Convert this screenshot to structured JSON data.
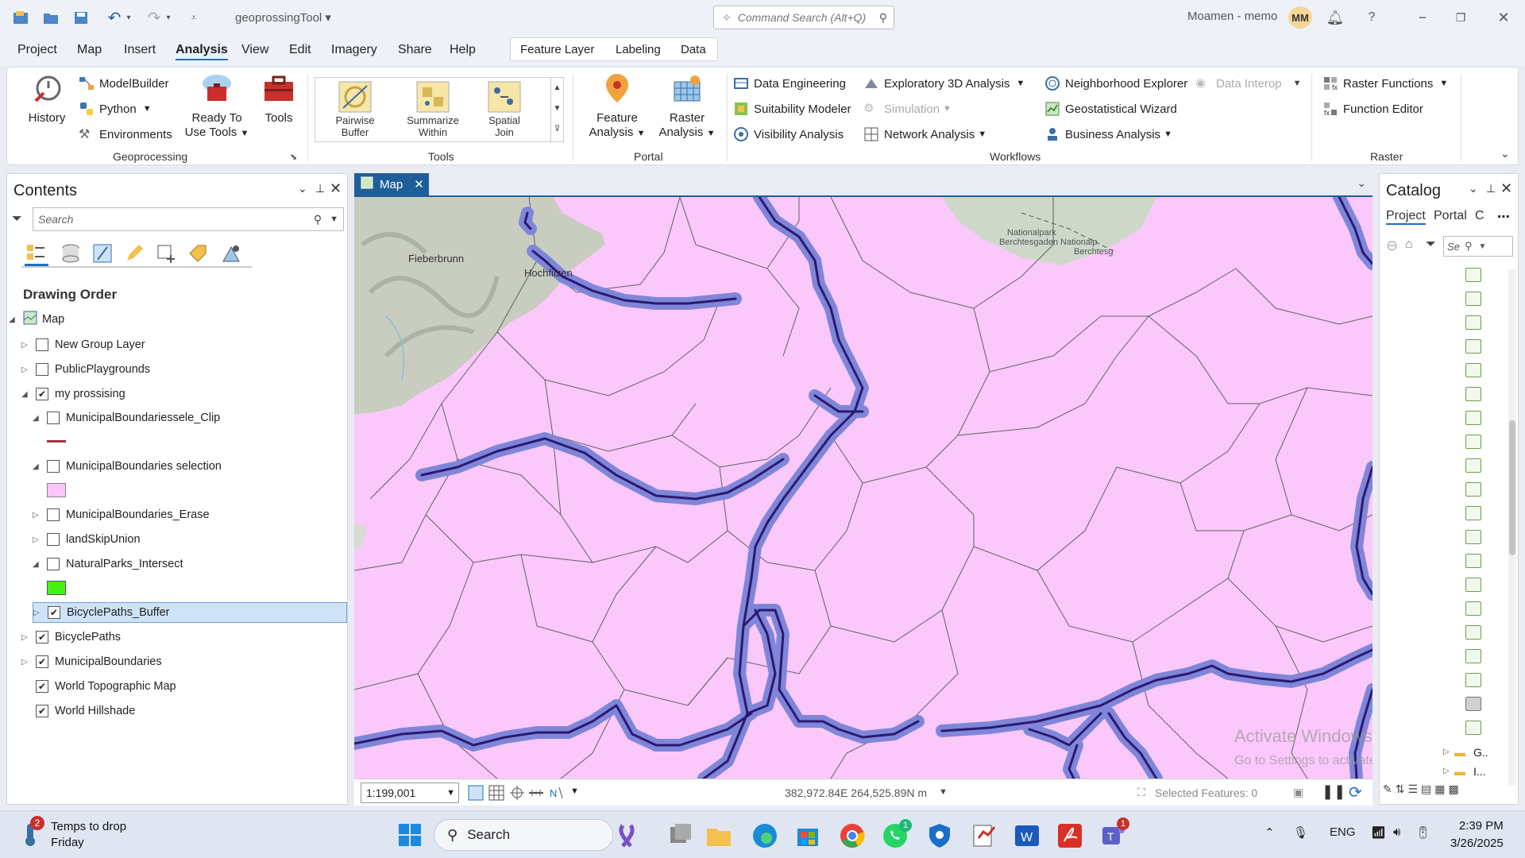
{
  "window": {
    "title": "geoprossingTool",
    "command_search_placeholder": "Command Search (Alt+Q)",
    "user": "Moamen - memo",
    "avatar_initials": "MM"
  },
  "menu": {
    "items": [
      "Project",
      "Map",
      "Insert",
      "Analysis",
      "View",
      "Edit",
      "Imagery",
      "Share",
      "Help"
    ],
    "active": "Analysis",
    "context_tabs": [
      "Feature Layer",
      "Labeling",
      "Data"
    ]
  },
  "ribbon": {
    "geoprocessing": {
      "label": "Geoprocessing",
      "history": "History",
      "modelbuilder": "ModelBuilder",
      "python": "Python",
      "environments": "Environments",
      "ready_to_use_1": "Ready To",
      "ready_to_use_2": "Use Tools",
      "tools": "Tools"
    },
    "tools": {
      "label": "Tools",
      "gallery": [
        {
          "l1": "Pairwise",
          "l2": "Buffer"
        },
        {
          "l1": "Summarize",
          "l2": "Within"
        },
        {
          "l1": "Spatial",
          "l2": "Join"
        }
      ]
    },
    "portal": {
      "label": "Portal",
      "feature_1": "Feature",
      "feature_2": "Analysis",
      "raster_1": "Raster",
      "raster_2": "Analysis"
    },
    "workflows": {
      "label": "Workflows",
      "data_engineering": "Data Engineering",
      "suitability_modeler": "Suitability Modeler",
      "visibility_analysis": "Visibility Analysis",
      "exploratory_3d": "Exploratory 3D Analysis",
      "simulation": "Simulation",
      "network_analysis": "Network Analysis",
      "neighborhood_explorer": "Neighborhood Explorer",
      "geostatistical_wizard": "Geostatistical Wizard",
      "business_analysis": "Business Analysis",
      "data_interop": "Data Interop"
    },
    "raster": {
      "label": "Raster",
      "raster_functions": "Raster Functions",
      "function_editor": "Function Editor"
    }
  },
  "contents": {
    "title": "Contents",
    "search_placeholder": "Search",
    "drawing_order": "Drawing Order",
    "layers": [
      {
        "name": "Map",
        "checked": null
      },
      {
        "name": "New Group Layer",
        "checked": false
      },
      {
        "name": "PublicPlaygrounds",
        "checked": false
      },
      {
        "name": "my prossising",
        "checked": true
      },
      {
        "name": "MunicipalBoundariessele_Clip",
        "checked": false
      },
      {
        "name": "MunicipalBoundaries selection",
        "checked": false
      },
      {
        "name": "MunicipalBoundaries_Erase",
        "checked": false
      },
      {
        "name": "landSkipUnion",
        "checked": false
      },
      {
        "name": "NaturalParks_Intersect",
        "checked": false
      },
      {
        "name": "BicyclePaths_Buffer",
        "checked": true
      },
      {
        "name": "BicyclePaths",
        "checked": true
      },
      {
        "name": "MunicipalBoundaries",
        "checked": true
      },
      {
        "name": "World Topographic Map",
        "checked": true
      },
      {
        "name": "World Hillshade",
        "checked": true
      }
    ],
    "colors": {
      "clip_line": "#a4323c",
      "selection_fill": "#f9c6f9",
      "intersect_fill": "#43f213"
    }
  },
  "map": {
    "tab_label": "Map",
    "places": [
      "Fieberbrunn",
      "Hochfilzen",
      "Nationalpark",
      "Berchtesgaden Nationalp",
      "Berchtesg"
    ],
    "scale": "1:199,001",
    "coordinates": "382,972.84E 264,525.89N m",
    "selected_features": "Selected Features: 0",
    "colors": {
      "fill": "#fbc8fb",
      "buffer": "#7f86d9",
      "path": "#2b1a6e",
      "boundary": "#606060"
    },
    "watermark_1": "Activate Windows",
    "watermark_2": "Go to Settings to activate Windows."
  },
  "catalog": {
    "title": "Catalog",
    "tabs": [
      "Project",
      "Portal",
      "C"
    ],
    "search_placeholder": "Se",
    "folder_labels": [
      "G..",
      "I..."
    ]
  },
  "taskbar": {
    "weather_badge": "2",
    "weather_line1": "Temps to drop",
    "weather_line2": "Friday",
    "search": "Search",
    "language": "ENG",
    "time": "2:39 PM",
    "date": "3/26/2025",
    "whatsapp_badge": "1",
    "teams_badge": "1"
  }
}
